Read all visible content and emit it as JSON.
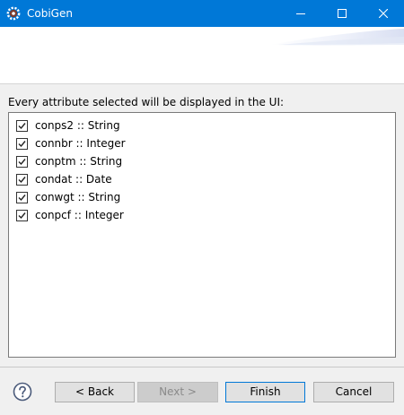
{
  "window": {
    "title": "CobiGen",
    "icon": "gear-icon",
    "accent_color": "#0078d7"
  },
  "description": "Every attribute selected will be displayed in the UI:",
  "attributes": [
    {
      "label": "conps2 :: String",
      "checked": true
    },
    {
      "label": "connbr :: Integer",
      "checked": true
    },
    {
      "label": "conptm :: String",
      "checked": true
    },
    {
      "label": "condat :: Date",
      "checked": true
    },
    {
      "label": "conwgt :: String",
      "checked": true
    },
    {
      "label": "conpcf :: Integer",
      "checked": true
    }
  ],
  "buttons": {
    "back": "< Back",
    "next": "Next >",
    "finish": "Finish",
    "cancel": "Cancel"
  }
}
